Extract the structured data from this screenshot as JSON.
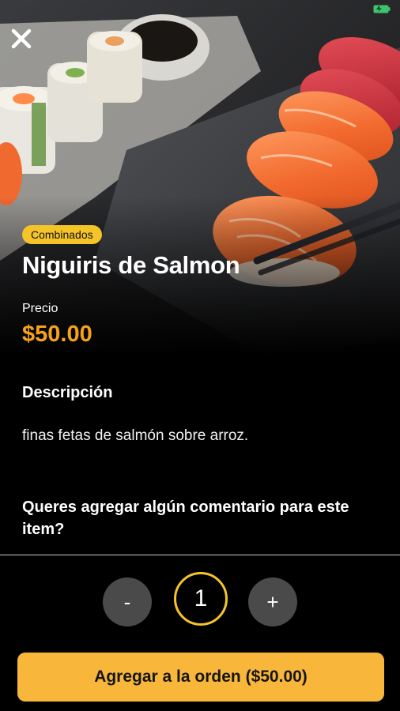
{
  "status_bar": {
    "battery_icon": "battery-charging-icon",
    "battery_color": "#3ec46d"
  },
  "header": {
    "close_icon": "close-icon"
  },
  "product": {
    "category": "Combinados",
    "name": "Niguiris de Salmon",
    "price_label": "Precio",
    "price": "$50.00",
    "image_description_icon": "sushi-photo"
  },
  "description": {
    "heading": "Descripción",
    "text": "finas fetas de salmón sobre arroz."
  },
  "comment": {
    "question": "Queres agregar algún comentario para este item?"
  },
  "quantity": {
    "minus_label": "-",
    "value": "1",
    "plus_label": "+"
  },
  "order_button": {
    "label": "Agregar a la orden ($50.00)"
  },
  "colors": {
    "accent_yellow": "#f5c428",
    "price_orange": "#f7a21b",
    "button_yellow": "#f8b73a",
    "background": "#000000",
    "qty_button_gray": "#4a4a4a"
  }
}
